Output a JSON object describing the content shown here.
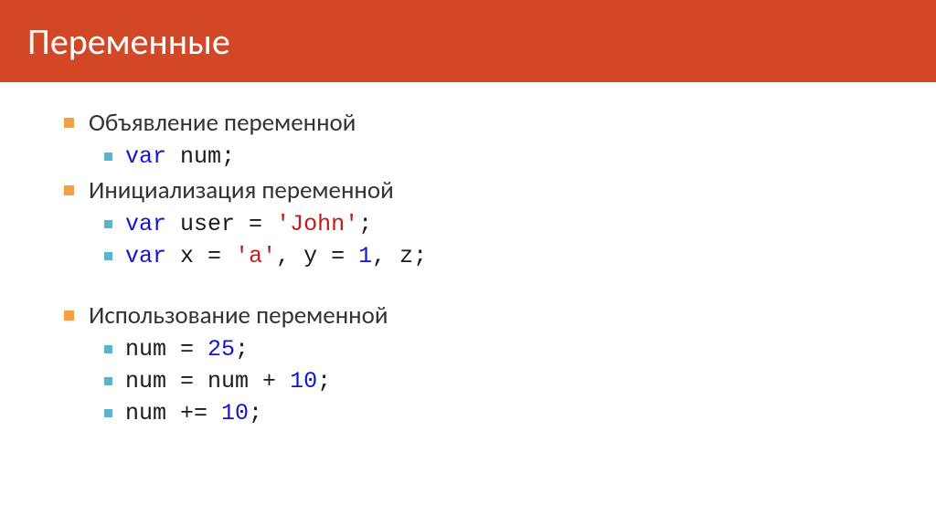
{
  "header": {
    "title": "Переменные"
  },
  "sections": [
    {
      "heading": "Объявление переменной",
      "lines": [
        {
          "tokens": [
            {
              "t": "var",
              "c": "kw"
            },
            {
              "t": " ",
              "c": ""
            },
            {
              "t": "num",
              "c": ""
            },
            {
              "t": ";",
              "c": "punct"
            }
          ]
        }
      ]
    },
    {
      "heading": "Инициализация переменной",
      "lines": [
        {
          "tokens": [
            {
              "t": "var",
              "c": "kw"
            },
            {
              "t": " ",
              "c": ""
            },
            {
              "t": "user",
              "c": ""
            },
            {
              "t": " = ",
              "c": ""
            },
            {
              "t": "'John'",
              "c": "str"
            },
            {
              "t": ";",
              "c": "punct"
            }
          ]
        },
        {
          "tokens": [
            {
              "t": "var",
              "c": "kw"
            },
            {
              "t": " ",
              "c": ""
            },
            {
              "t": "x",
              "c": ""
            },
            {
              "t": " = ",
              "c": ""
            },
            {
              "t": "'a'",
              "c": "str"
            },
            {
              "t": ", ",
              "c": "punct"
            },
            {
              "t": "y",
              "c": ""
            },
            {
              "t": " = ",
              "c": ""
            },
            {
              "t": "1",
              "c": "num-lit"
            },
            {
              "t": ", ",
              "c": "punct"
            },
            {
              "t": "z",
              "c": ""
            },
            {
              "t": ";",
              "c": "punct"
            }
          ]
        }
      ],
      "spacer_after": true
    },
    {
      "heading": "Использование переменной",
      "lines": [
        {
          "tokens": [
            {
              "t": "num",
              "c": ""
            },
            {
              "t": " = ",
              "c": ""
            },
            {
              "t": "25",
              "c": "num-lit"
            },
            {
              "t": ";",
              "c": "punct"
            }
          ]
        },
        {
          "tokens": [
            {
              "t": "num",
              "c": ""
            },
            {
              "t": " = ",
              "c": ""
            },
            {
              "t": "num",
              "c": ""
            },
            {
              "t": " + ",
              "c": ""
            },
            {
              "t": "10",
              "c": "num-lit"
            },
            {
              "t": ";",
              "c": "punct"
            }
          ]
        },
        {
          "tokens": [
            {
              "t": "num",
              "c": ""
            },
            {
              "t": " += ",
              "c": ""
            },
            {
              "t": "10",
              "c": "num-lit"
            },
            {
              "t": ";",
              "c": "punct"
            }
          ]
        }
      ]
    }
  ]
}
